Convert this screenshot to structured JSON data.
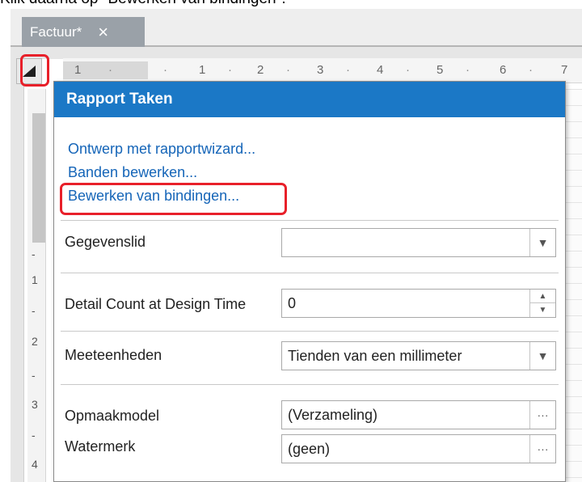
{
  "caption": "Klik daarna op \"Bewerken van bindingen\".",
  "document_tab": {
    "title": "Factuur*",
    "close": "×"
  },
  "ruler": {
    "marks": [
      "1",
      "·",
      "·",
      "1",
      "·",
      "2",
      "·",
      "3",
      "·",
      "4",
      "·",
      "5",
      "·",
      "6",
      "·",
      "7"
    ]
  },
  "vertical_ruler": {
    "marks": [
      "-",
      "1",
      "-",
      "2",
      "-",
      "3",
      "-",
      "4"
    ]
  },
  "panel": {
    "title": "Rapport Taken",
    "links": {
      "wizard": "Ontwerp met rapportwizard...",
      "bands": "Banden bewerken...",
      "bindings": "Bewerken van bindingen..."
    },
    "properties": {
      "data_member": {
        "label": "Gegevenslid",
        "value": ""
      },
      "detail_count": {
        "label": "Detail Count at Design Time",
        "value": "0"
      },
      "units": {
        "label": "Meeteenheden",
        "value": "Tienden van een millimeter"
      },
      "style_sheet": {
        "label": "Opmaakmodel",
        "value": "(Verzameling)"
      },
      "watermark": {
        "label": "Watermerk",
        "value": "(geen)"
      }
    },
    "ellipsis": "···"
  },
  "colors": {
    "header_blue": "#1b78c6",
    "link_blue": "#1565b8",
    "highlight_red": "#e8202a"
  }
}
